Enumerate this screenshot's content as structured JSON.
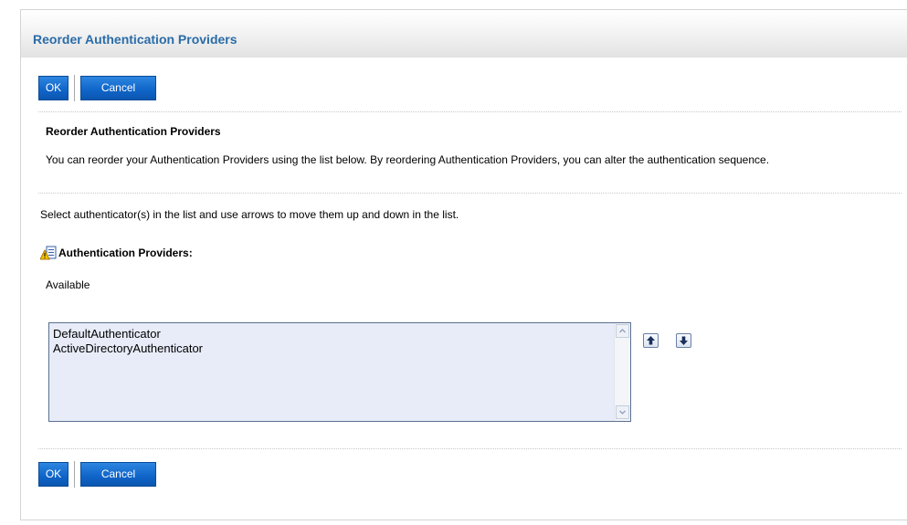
{
  "header": {
    "title": "Reorder Authentication Providers"
  },
  "buttons_top": {
    "ok_label": "OK",
    "cancel_label": "Cancel"
  },
  "buttons_bottom": {
    "ok_label": "OK",
    "cancel_label": "Cancel"
  },
  "section": {
    "heading": "Reorder Authentication Providers",
    "description": "You can reorder your Authentication Providers using the list below. By reordering Authentication Providers, you can alter the authentication sequence.",
    "instruction": "Select authenticator(s) in the list and use arrows to move them up and down in the list."
  },
  "providers": {
    "label": "Authentication Providers:",
    "available_label": "Available",
    "items": [
      {
        "label": "DefaultAuthenticator"
      },
      {
        "label": "ActiveDirectoryAuthenticator"
      }
    ]
  },
  "icons": {
    "field_icon": "required-field-icon",
    "move_up": "arrow-up-icon",
    "move_down": "arrow-down-icon",
    "scroll_up": "scroll-up-arrow-icon",
    "scroll_down": "scroll-down-arrow-icon"
  },
  "colors": {
    "title": "#2a6ca8",
    "button": "#0f64c8",
    "list_background": "#e7ecf8"
  }
}
